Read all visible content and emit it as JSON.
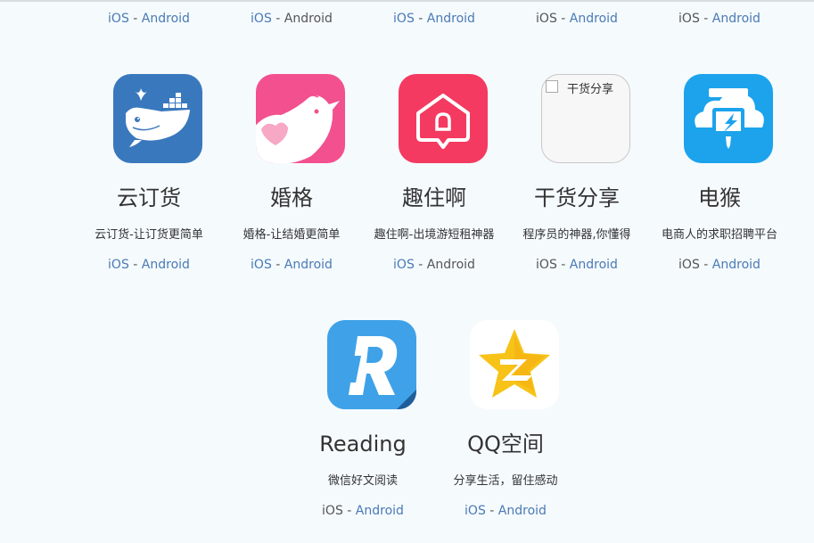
{
  "platforms": {
    "ios": "iOS",
    "sep": " - ",
    "android": "Android"
  },
  "top_row": [
    {
      "ios_color": "#4a7ab5",
      "android_color": "#4a7ab5"
    },
    {
      "ios_color": "#4a7ab5",
      "android_color": "#555555"
    },
    {
      "ios_color": "#4a7ab5",
      "android_color": "#4a7ab5"
    },
    {
      "ios_color": "#555555",
      "android_color": "#4a7ab5"
    },
    {
      "ios_color": "#555555",
      "android_color": "#4a7ab5"
    }
  ],
  "apps": [
    {
      "name": "云订货",
      "desc": "云订货-让订货更简单",
      "icon": "whale-docker-icon",
      "ios_color": "#4a7ab5",
      "android_color": "#4a7ab5"
    },
    {
      "name": "婚格",
      "desc": "婚格-让结婚更简单",
      "icon": "bird-heart-icon",
      "ios_color": "#4a7ab5",
      "android_color": "#4a7ab5"
    },
    {
      "name": "趣住啊",
      "desc": "趣住啊-出境游短租神器",
      "icon": "house-pin-icon",
      "ios_color": "#4a7ab5",
      "android_color": "#555555"
    },
    {
      "name": "干货分享",
      "desc": "程序员的神器,你懂得",
      "icon": "broken-image-icon",
      "icon_alt": "干货分享",
      "ios_color": "#555555",
      "android_color": "#4a7ab5"
    },
    {
      "name": "电猴",
      "desc": "电商人的求职招聘平台",
      "icon": "monkey-cloud-icon",
      "ios_color": "#555555",
      "android_color": "#4a7ab5"
    },
    {
      "name": "Reading",
      "desc": "微信好文阅读",
      "icon": "reading-r-icon",
      "ios_color": "#555555",
      "android_color": "#4a7ab5"
    },
    {
      "name": "QQ空间",
      "desc": "分享生活，留住感动",
      "icon": "qzone-star-icon",
      "ios_color": "#4a7ab5",
      "android_color": "#4a7ab5"
    }
  ]
}
